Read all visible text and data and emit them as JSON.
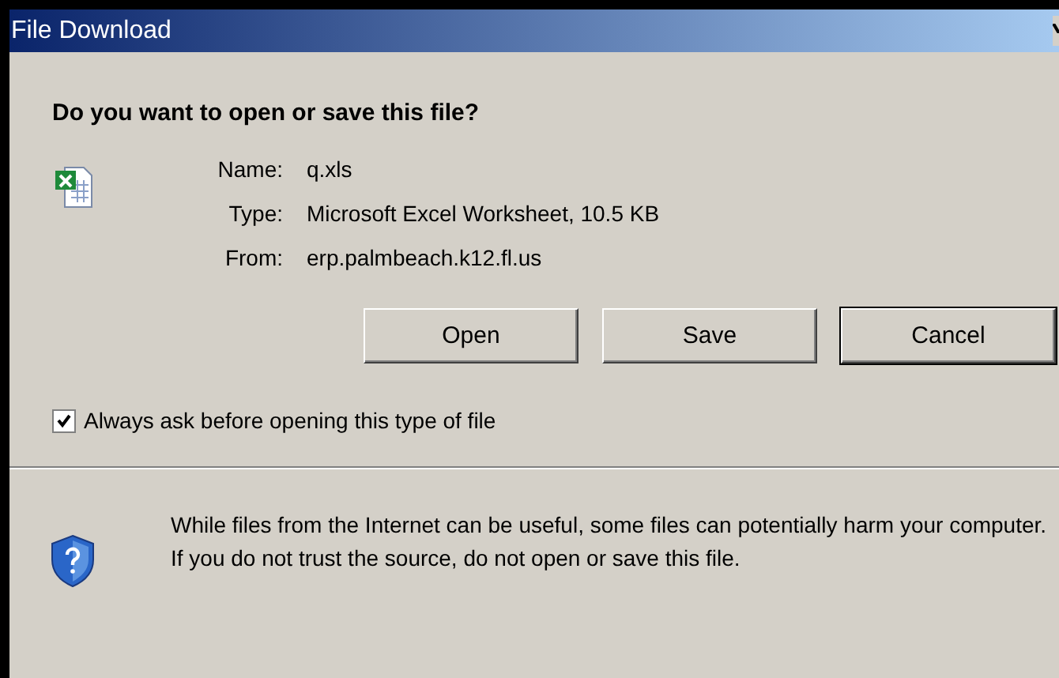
{
  "window": {
    "title": "File Download"
  },
  "question": "Do you want to open or save this file?",
  "fields": [
    {
      "label": "Name:",
      "value": "q.xls"
    },
    {
      "label": "Type:",
      "value": "Microsoft Excel Worksheet, 10.5 KB"
    },
    {
      "label": "From:",
      "value": "erp.palmbeach.k12.fl.us"
    }
  ],
  "buttons": [
    {
      "label": "Open",
      "default": false
    },
    {
      "label": "Save",
      "default": false
    },
    {
      "label": "Cancel",
      "default": true
    }
  ],
  "always_ask": {
    "label": "Always ask before opening this type of file",
    "checked": true
  },
  "warning": "While files from the Internet can be useful, some files can potentially harm your computer. If you do not trust the source, do not open or save this file."
}
